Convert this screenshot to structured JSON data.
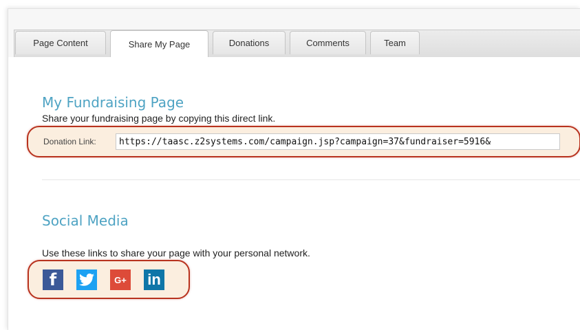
{
  "tabs": [
    {
      "label": "Page Content",
      "active": false
    },
    {
      "label": "Share My Page",
      "active": true
    },
    {
      "label": "Donations",
      "active": false
    },
    {
      "label": "Comments",
      "active": false
    },
    {
      "label": "Team",
      "active": false
    }
  ],
  "fundraising": {
    "title": "My Fundraising Page",
    "description": "Share your fundraising page by copying this direct link.",
    "link_label": "Donation Link:",
    "link_value": "https://taasc.z2systems.com/campaign.jsp?campaign=37&fundraiser=5916&"
  },
  "social": {
    "title": "Social Media",
    "description": "Use these links to share your page with your personal network.",
    "buttons": [
      {
        "icon": "facebook-icon",
        "glyph": "f",
        "color": "#3b5998"
      },
      {
        "icon": "twitter-icon",
        "glyph": "",
        "color": "#1da1f2"
      },
      {
        "icon": "google-plus-icon",
        "glyph": "G+",
        "color": "#dd4b39"
      },
      {
        "icon": "linkedin-icon",
        "glyph": "in",
        "color": "#0e76a8"
      }
    ]
  },
  "colors": {
    "heading": "#4ea3c3",
    "highlight_border": "#b8321e",
    "highlight_fill": "#fbeedf"
  }
}
